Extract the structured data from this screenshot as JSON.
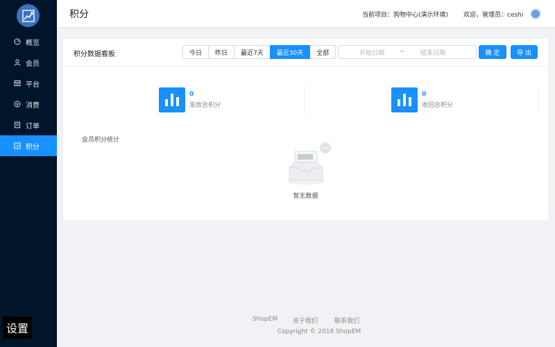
{
  "sidebar": {
    "items": [
      {
        "label": "概览",
        "icon": "dashboard-icon"
      },
      {
        "label": "会员",
        "icon": "user-icon"
      },
      {
        "label": "平台",
        "icon": "platform-icon"
      },
      {
        "label": "消费",
        "icon": "money-icon"
      },
      {
        "label": "订单",
        "icon": "order-icon"
      },
      {
        "label": "积分",
        "icon": "points-icon",
        "active": true
      }
    ],
    "settings_label": "设置"
  },
  "header": {
    "title": "积分",
    "project": "当前项目：购物中心(演示环境)",
    "welcome": "欢迎，管理员：ceshi"
  },
  "panel": {
    "title": "积分数据看板",
    "ranges": [
      "今日",
      "昨日",
      "最近7天",
      "最近30天",
      "全部"
    ],
    "active_range": "最近30天",
    "date_start_placeholder": "开始日期",
    "date_sep": "~",
    "date_end_placeholder": "结束日期",
    "confirm_label": "确 定",
    "export_label": "导 出",
    "stats": [
      {
        "value": "0",
        "label": "发放总积分"
      },
      {
        "value": "0",
        "label": "收回总积分"
      }
    ],
    "section_title": "会员积分统计",
    "empty_text": "暂无数据"
  },
  "footer": {
    "links": [
      "ShopEM",
      "关于我们",
      "联系我们"
    ],
    "copyright": "Copyright © 2018 ShopEM"
  },
  "colors": {
    "sidebar_bg": "#001529",
    "primary": "#1890ff",
    "page_bg": "#f0f2f5"
  }
}
